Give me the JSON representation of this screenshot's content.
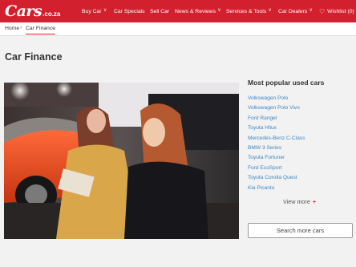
{
  "header": {
    "logo_main": "Cars",
    "logo_suffix": ".co.za",
    "nav": [
      {
        "label": "Buy Car",
        "chevron": "v"
      },
      {
        "label": "Car Specials"
      },
      {
        "label": "Sell Car"
      },
      {
        "label": "News & Reviews",
        "chevron": "v"
      },
      {
        "label": "Services & Tools",
        "chevron": "v"
      },
      {
        "label": "Car Dealers",
        "chevron": "v"
      },
      {
        "label": "Wishlist (0)",
        "icon": "♡"
      }
    ]
  },
  "breadcrumb": {
    "home": "Home",
    "separator": "›",
    "current": "Car Finance"
  },
  "page": {
    "title": "Car Finance"
  },
  "sidebar": {
    "title": "Most popular used cars",
    "items": [
      "Volkswagen Polo",
      "Volkswagen Polo Vivo",
      "Ford Ranger",
      "Toyota Hilux",
      "Mercedes-Benz C-Class",
      "BMW 3 Series",
      "Toyota Fortuner",
      "Ford EcoSport",
      "Toyota Corolla Quest",
      "Kia Picanto"
    ],
    "view_more": "View more",
    "view_more_icon": "+",
    "search_button": "Search more cars"
  },
  "colors": {
    "brand": "#d3202e",
    "link": "#3e86c4"
  }
}
